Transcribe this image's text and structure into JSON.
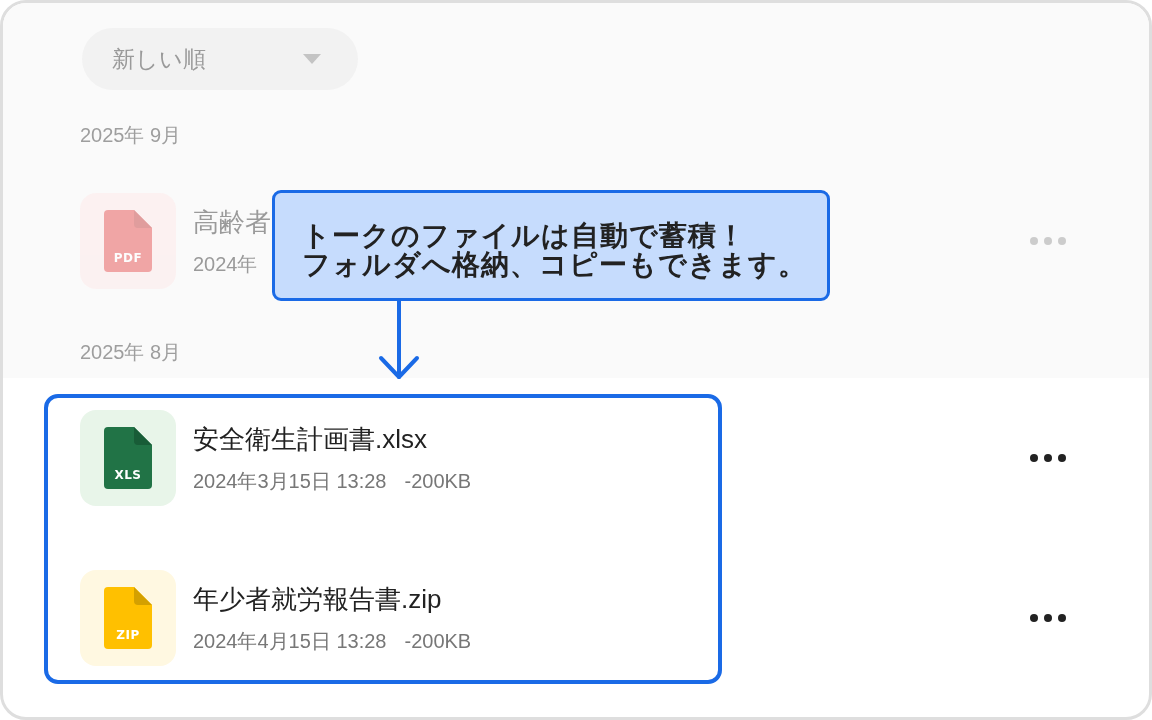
{
  "sort_dropdown": {
    "label": "新しい順"
  },
  "groups": [
    {
      "heading": "2025年 9月",
      "files": [
        {
          "kind": "pdf",
          "type_label": "PDF",
          "name": "高齢者",
          "date": "2024年",
          "highlighted": false
        }
      ]
    },
    {
      "heading": "2025年 8月",
      "files": [
        {
          "kind": "xls",
          "type_label": "XLS",
          "name": "安全衛生計画書.xlsx",
          "date": "2024年3月15日 13:28",
          "size": "-200KB",
          "highlighted": true
        },
        {
          "kind": "zip",
          "type_label": "ZIP",
          "name": "年少者就労報告書.zip",
          "date": "2024年4月15日 13:28",
          "size": "-200KB",
          "highlighted": true
        }
      ]
    }
  ],
  "callout": {
    "lines": [
      "トークのファイルは自動で蓄積！",
      "フォルダへ格納、コピーもできます。"
    ]
  }
}
